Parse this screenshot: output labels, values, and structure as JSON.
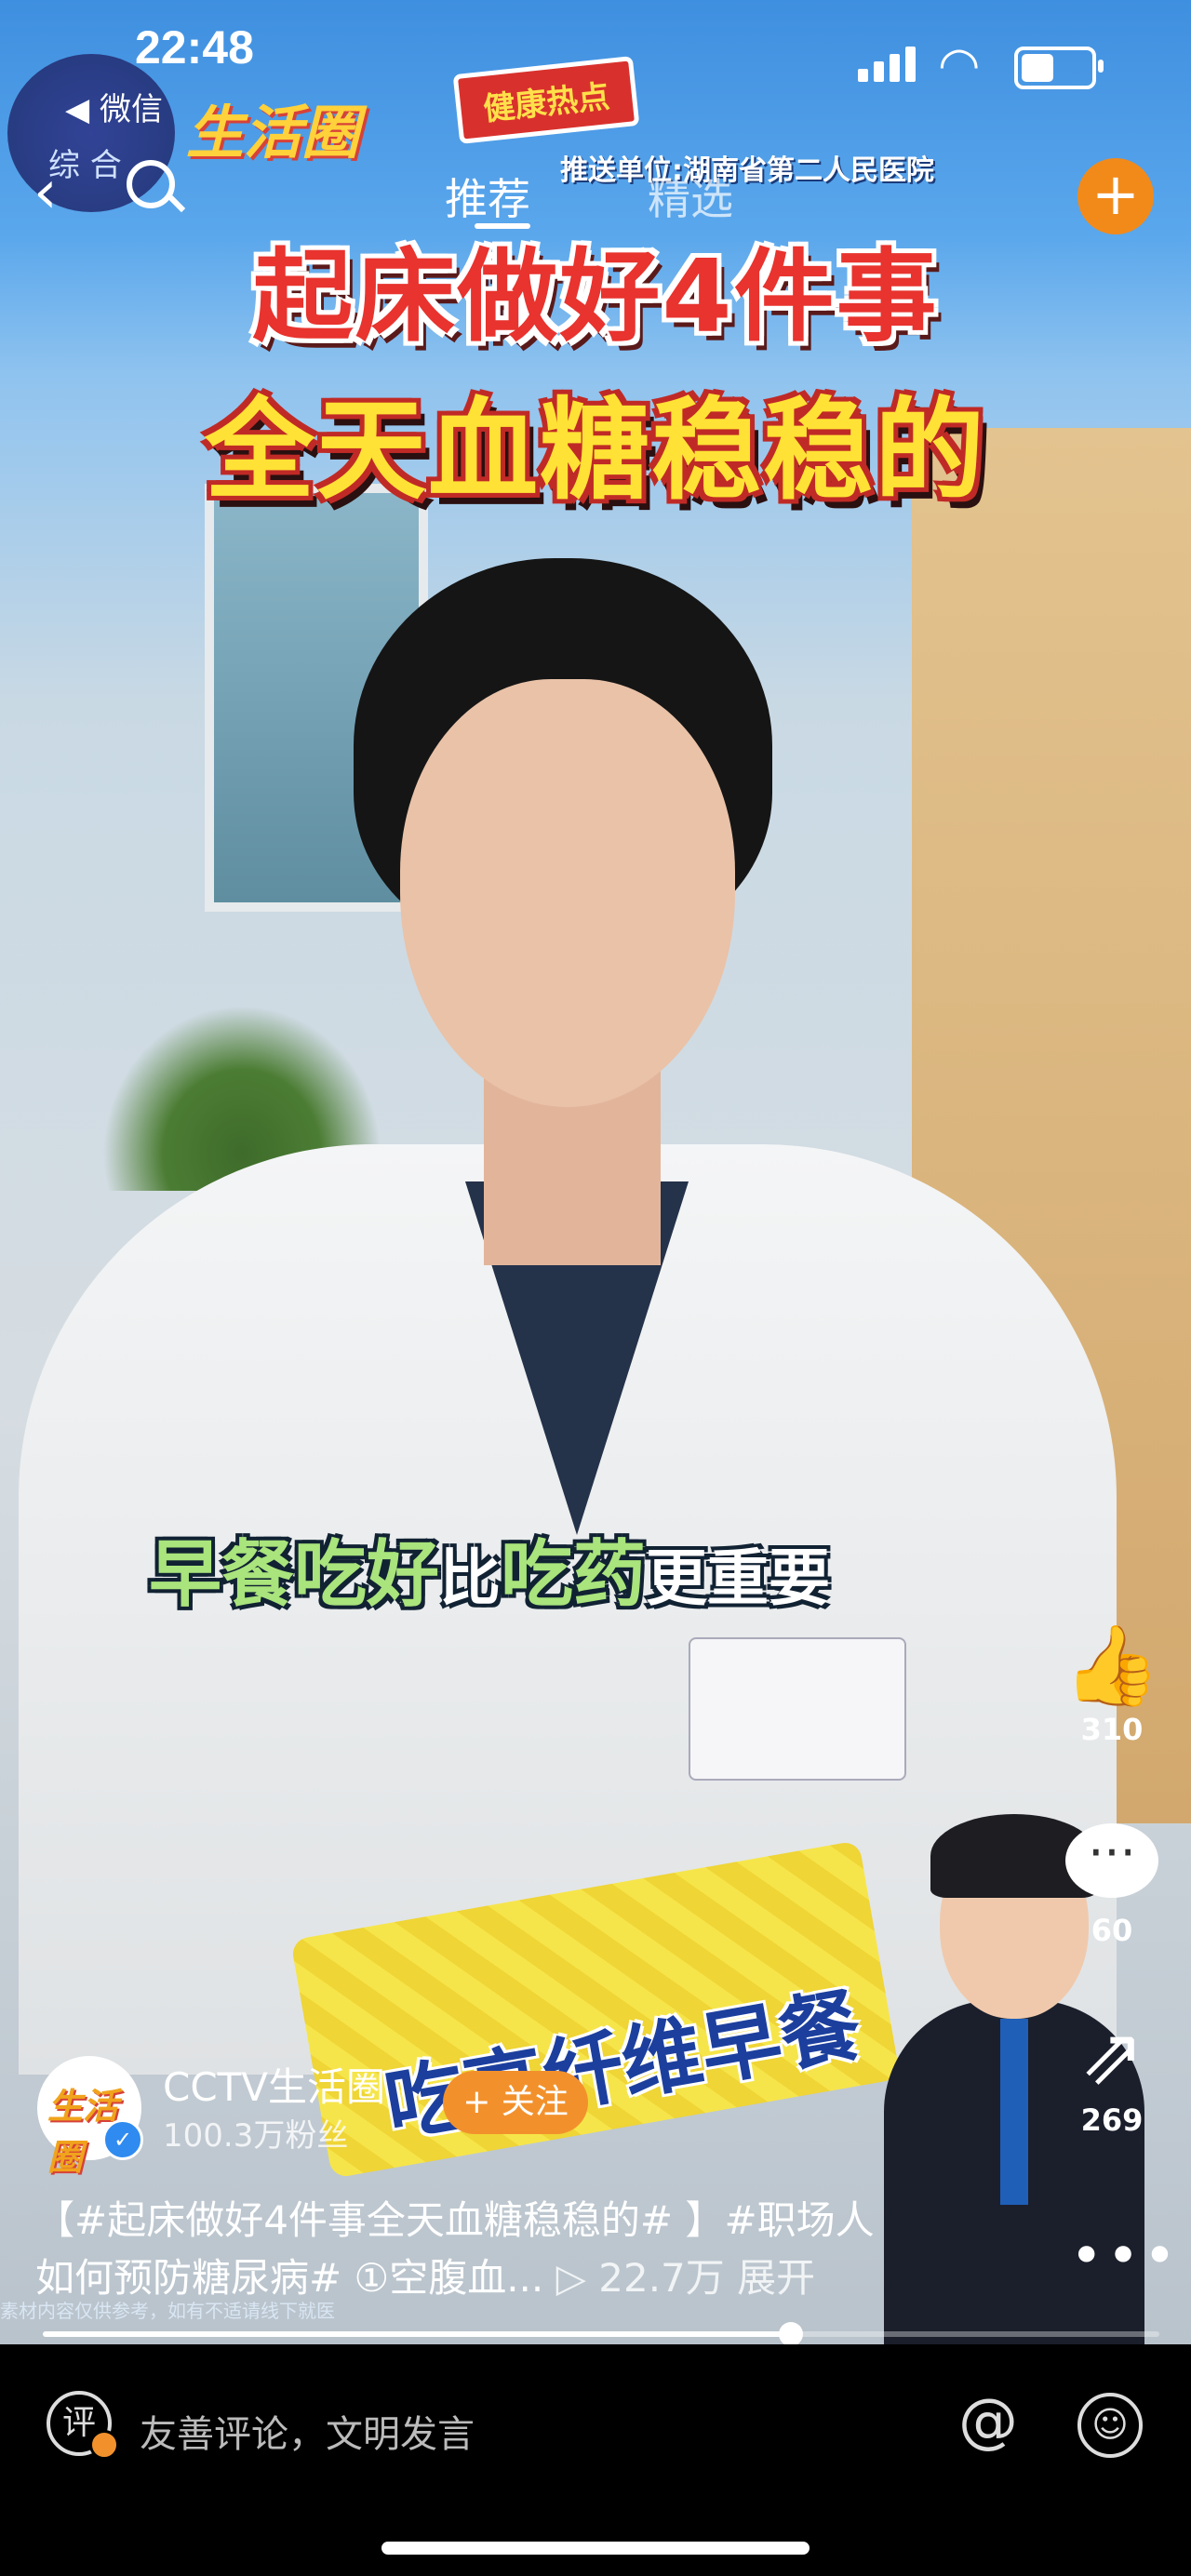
{
  "status_bar": {
    "time": "22:48"
  },
  "wechat_float": {
    "label": "◀ 微信",
    "sub": "综 合"
  },
  "header": {
    "logo": "生活圈",
    "health_tag": "健康热点",
    "push_unit": "推送单位:湖南省第二人民医院",
    "tabs": [
      "推荐",
      "精选"
    ],
    "active_tab": "推荐"
  },
  "video": {
    "title_line1": "起床做好4件事",
    "title_line2": "全天血糖稳稳的",
    "subtitle_part1": "早餐吃好",
    "subtitle_part2": "比",
    "subtitle_part3": "吃药",
    "subtitle_part4": "更重要",
    "badge_text": "吃高纤维早餐"
  },
  "rail": {
    "likes": "310",
    "comments": "60",
    "shares": "269"
  },
  "author": {
    "avatar_text": "生活圈",
    "name": "CCTV生活圈",
    "fans": "100.3万粉丝",
    "follow_label": "+ 关注"
  },
  "caption": {
    "line1": "【#起床做好4件事全天血糖稳稳的# 】#职场人",
    "line2": "如何预防糖尿病# ①空腹血...",
    "views": "▷ 22.7万",
    "expand": "展开",
    "disclaimer": "素材内容仅供参考，如有不适请线下就医"
  },
  "progress": {
    "played_fraction": 0.67
  },
  "bottom_bar": {
    "comment_icon": "评",
    "comment_placeholder": "友善评论，文明发言",
    "at_icon": "@",
    "emoji_icon": "☺"
  },
  "colors": {
    "accent": "#f2912c",
    "title_red": "#e8332e",
    "title_yellow": "#ffe235"
  }
}
